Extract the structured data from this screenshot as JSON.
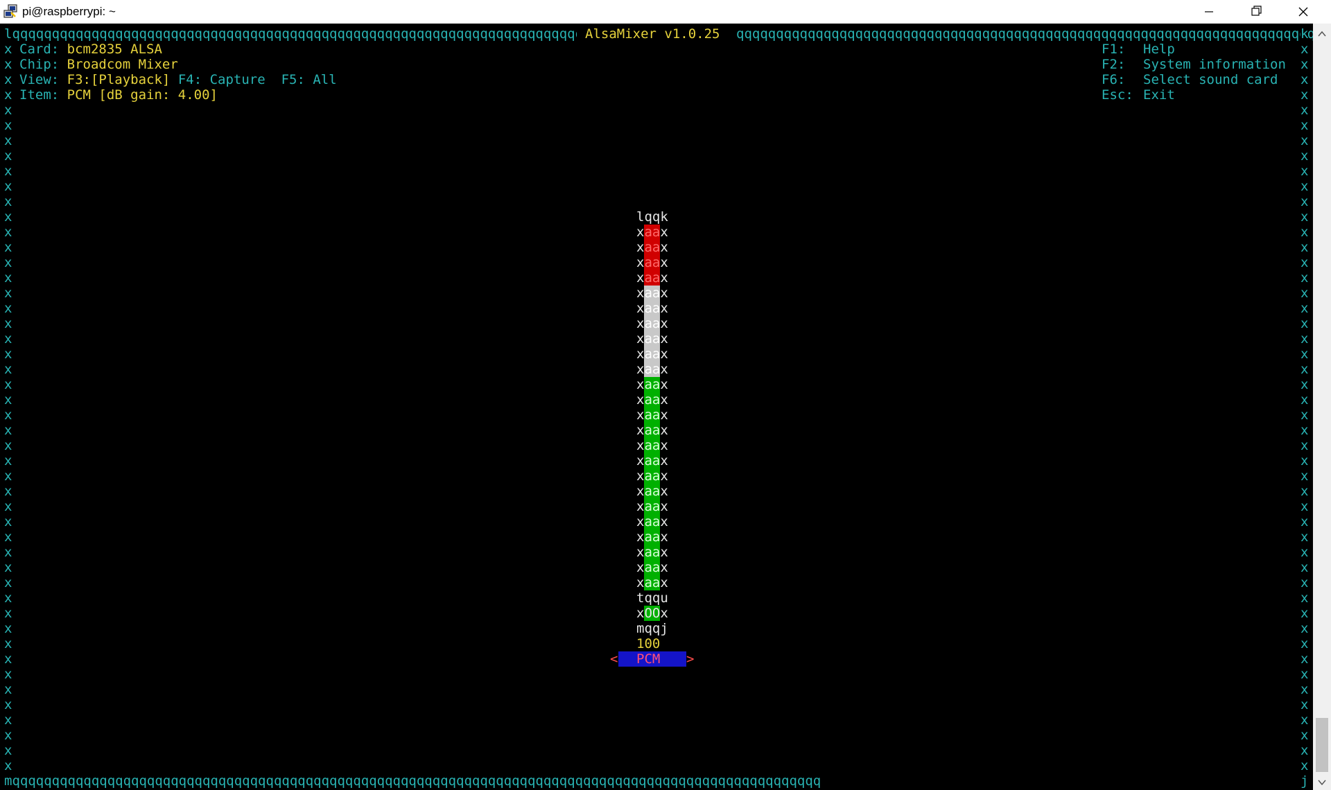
{
  "window": {
    "title": "pi@raspberrypi: ~"
  },
  "frame": {
    "top_left": "l",
    "top_fill": "qqqqqqqqqqqqqqqqqqqqqqqqqqqqqqqqqqqqqqqqqqqqqqqqqqqqqqqqqqqqqqqqqqqqqqqqqqqqqqqqqqqqqqqqqqqqqqqqqqqqqq",
    "top_right": "k",
    "side": "x",
    "bottom_left": "m",
    "bottom_right": "j"
  },
  "app_title": "AlsaMixer v1.0.25",
  "info": {
    "card_label": "Card:",
    "card_value": "bcm2835 ALSA",
    "chip_label": "Chip:",
    "chip_value": "Broadcom Mixer",
    "view_label": "View:",
    "view_f3": "F3:[Playback]",
    "view_f4": "F4: Capture",
    "view_f5": "F5: All",
    "item_label": "Item:",
    "item_value": "PCM [dB gain: 4.00]"
  },
  "keys": [
    {
      "key": "F1:",
      "action": "Help"
    },
    {
      "key": "F2:",
      "action": "System information"
    },
    {
      "key": "F6:",
      "action": "Select sound card"
    },
    {
      "key": "Esc:",
      "action": "Exit"
    }
  ],
  "channel": {
    "name": "PCM",
    "volume_value": "100",
    "level_fraction": 1.0,
    "bar_glyphs": "aa",
    "top_border": "lqqk",
    "mid_border": "tqqu",
    "bottom_border": "mqqj",
    "mute_glyphs": "OO",
    "arrow_left": "<",
    "arrow_right": ">"
  },
  "colors": {
    "border": "#29b3b3",
    "text_yellow": "#e6d23c",
    "bar_red": "#d00000",
    "bar_white": "#c8c8c8",
    "bar_green": "#00b000",
    "selected_bg": "#1414c8",
    "selected_fg": "#ff5078"
  }
}
